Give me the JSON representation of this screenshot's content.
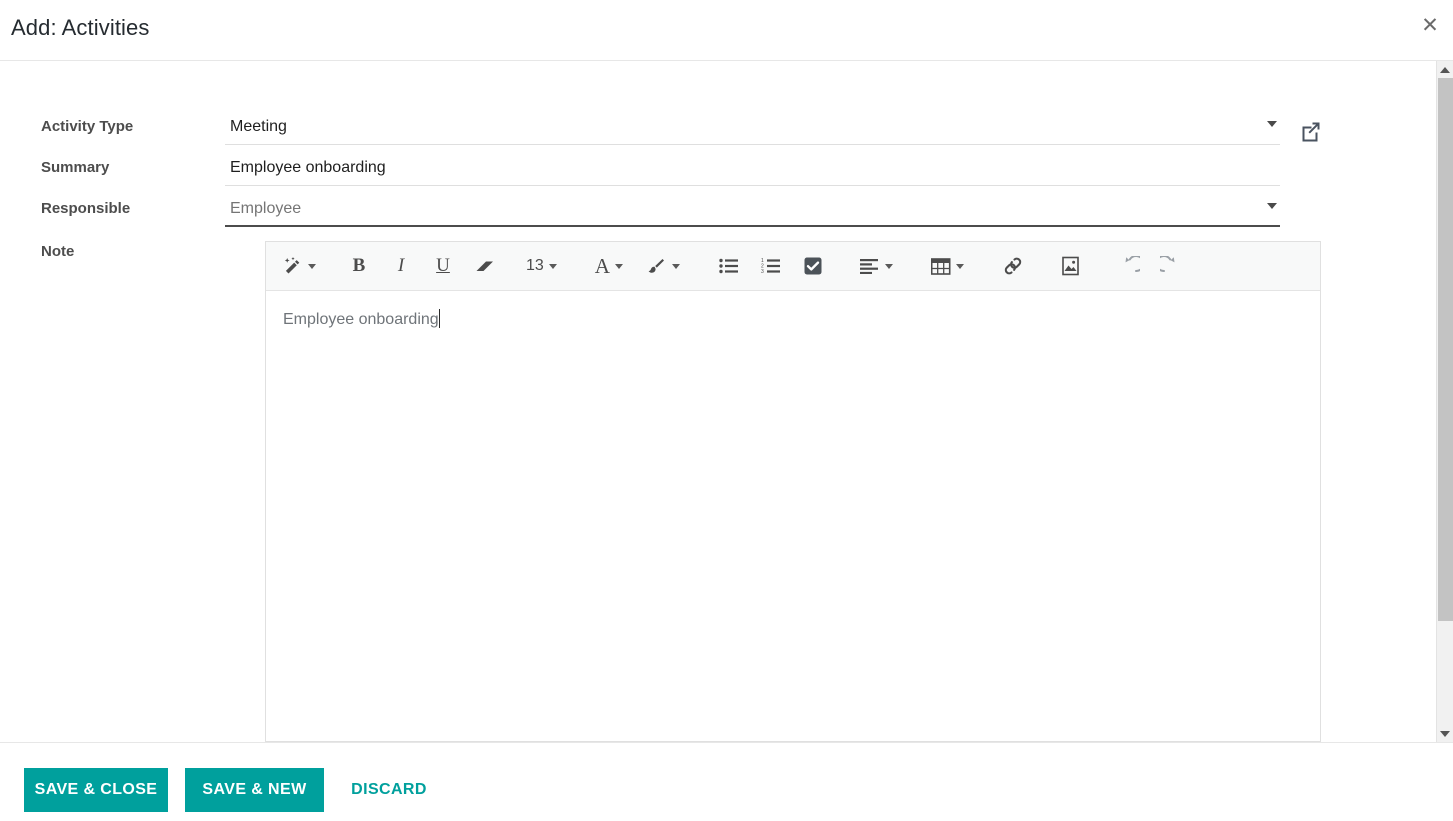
{
  "dialog": {
    "title": "Add: Activities",
    "close_icon": "close-icon",
    "close_label": "✕"
  },
  "form": {
    "fields": [
      {
        "label": "Activity Type",
        "value": "Meeting",
        "placeholder": "",
        "type": "select",
        "has_dropdown": true,
        "has_external_link": true,
        "focused": false,
        "is_placeholder": false
      },
      {
        "label": "Summary",
        "value": "Employee onboarding",
        "placeholder": "",
        "type": "text",
        "has_dropdown": false,
        "has_external_link": false,
        "focused": false,
        "is_placeholder": false
      },
      {
        "label": "Responsible",
        "value": "",
        "placeholder": "Employee",
        "type": "select",
        "has_dropdown": true,
        "has_external_link": false,
        "focused": true,
        "is_placeholder": true
      }
    ],
    "note": {
      "label": "Note",
      "content": "Employee onboarding"
    }
  },
  "editor_toolbar": {
    "font_size": "13",
    "buttons": [
      {
        "name": "style-magicwand-icon",
        "label": "",
        "icon": "magic-wand",
        "dropdown": true
      },
      {
        "name": "bold-button",
        "label": "B",
        "icon": "bold",
        "dropdown": false
      },
      {
        "name": "italic-button",
        "label": "I",
        "icon": "italic",
        "dropdown": false
      },
      {
        "name": "underline-button",
        "label": "U",
        "icon": "underline",
        "dropdown": false
      },
      {
        "name": "remove-format-button",
        "label": "",
        "icon": "eraser",
        "dropdown": false
      },
      {
        "name": "font-size-button",
        "label": "13",
        "icon": "font-size",
        "dropdown": true
      },
      {
        "name": "font-color-button",
        "label": "A",
        "icon": "font-color",
        "dropdown": true
      },
      {
        "name": "background-color-button",
        "label": "",
        "icon": "paint-brush",
        "dropdown": true
      },
      {
        "name": "unordered-list-button",
        "label": "",
        "icon": "bullet-list",
        "dropdown": false
      },
      {
        "name": "ordered-list-button",
        "label": "",
        "icon": "numbered-list",
        "dropdown": false
      },
      {
        "name": "checklist-button",
        "label": "",
        "icon": "checkbox-checked",
        "dropdown": false
      },
      {
        "name": "align-button",
        "label": "",
        "icon": "align-left",
        "dropdown": true
      },
      {
        "name": "table-button",
        "label": "",
        "icon": "table",
        "dropdown": true
      },
      {
        "name": "link-button",
        "label": "",
        "icon": "chain-link",
        "dropdown": false
      },
      {
        "name": "image-button",
        "label": "",
        "icon": "image",
        "dropdown": false
      },
      {
        "name": "undo-button",
        "label": "",
        "icon": "undo-arrow",
        "dropdown": false
      },
      {
        "name": "redo-button",
        "label": "",
        "icon": "redo-arrow",
        "dropdown": false
      }
    ]
  },
  "footer": {
    "save_close_label": "SAVE & CLOSE",
    "save_new_label": "SAVE & NEW",
    "discard_label": "DISCARD"
  },
  "colors": {
    "accent": "#00A09D",
    "label_text": "#4d4d4d",
    "placeholder_text": "#8a8a8a",
    "border": "#e0e0e0",
    "toolbar_bg": "#f8f9f9",
    "scrollbar_thumb": "#c3c3c3"
  }
}
